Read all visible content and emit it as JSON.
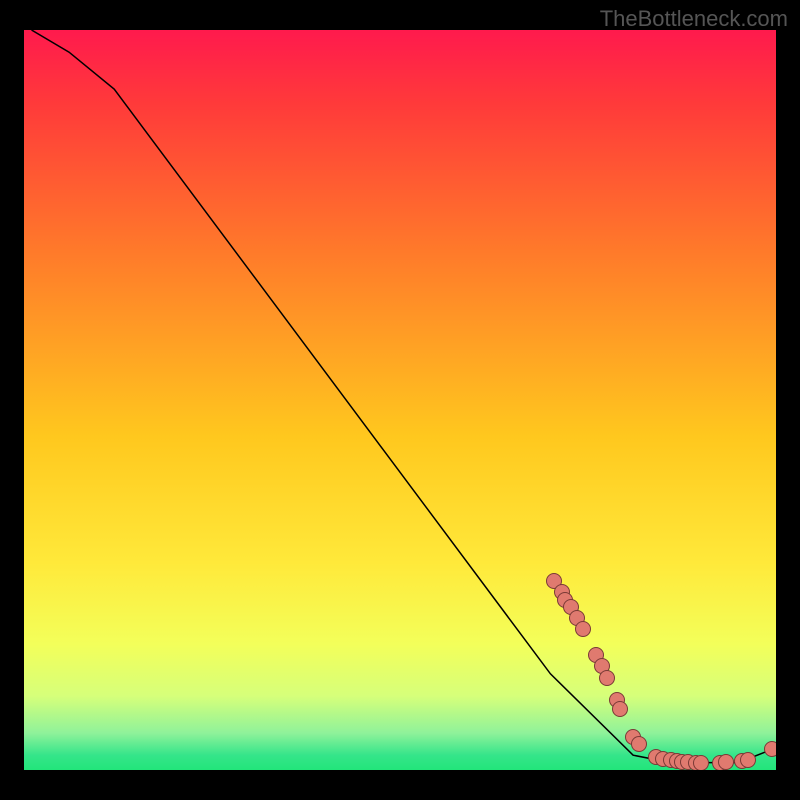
{
  "watermark": "TheBottleneck.com",
  "colors": {
    "marker_fill": "#e07a6f",
    "marker_stroke": "#7a3a37",
    "curve": "#000000",
    "gradient_top": "#ff1a4d",
    "gradient_mid": "#ffd500",
    "gradient_bottom": "#22e57a"
  },
  "chart_data": {
    "type": "line",
    "title": "",
    "xlabel": "",
    "ylabel": "",
    "xlim": [
      0,
      100
    ],
    "ylim": [
      0,
      100
    ],
    "grid": false,
    "legend": false,
    "curve": [
      {
        "x": 1,
        "y": 100
      },
      {
        "x": 6,
        "y": 97
      },
      {
        "x": 12,
        "y": 92
      },
      {
        "x": 70,
        "y": 13
      },
      {
        "x": 71,
        "y": 12
      },
      {
        "x": 81,
        "y": 2
      },
      {
        "x": 86,
        "y": 1
      },
      {
        "x": 95,
        "y": 1
      },
      {
        "x": 100,
        "y": 3
      }
    ],
    "series": [
      {
        "name": "markers",
        "points": [
          {
            "x": 70.5,
            "y": 25.5
          },
          {
            "x": 71.5,
            "y": 24.0
          },
          {
            "x": 72.0,
            "y": 23.0
          },
          {
            "x": 72.8,
            "y": 22.0
          },
          {
            "x": 73.5,
            "y": 20.5
          },
          {
            "x": 74.3,
            "y": 19.0
          },
          {
            "x": 76.0,
            "y": 15.5
          },
          {
            "x": 76.8,
            "y": 14.0
          },
          {
            "x": 77.5,
            "y": 12.5
          },
          {
            "x": 78.8,
            "y": 9.5
          },
          {
            "x": 79.3,
            "y": 8.3
          },
          {
            "x": 81.0,
            "y": 4.5
          },
          {
            "x": 81.8,
            "y": 3.5
          },
          {
            "x": 84.0,
            "y": 1.8
          },
          {
            "x": 85.0,
            "y": 1.5
          },
          {
            "x": 86.0,
            "y": 1.3
          },
          {
            "x": 86.8,
            "y": 1.2
          },
          {
            "x": 87.5,
            "y": 1.1
          },
          {
            "x": 88.3,
            "y": 1.1
          },
          {
            "x": 89.3,
            "y": 1.0
          },
          {
            "x": 90.0,
            "y": 1.0
          },
          {
            "x": 92.5,
            "y": 1.0
          },
          {
            "x": 93.3,
            "y": 1.1
          },
          {
            "x": 95.5,
            "y": 1.2
          },
          {
            "x": 96.3,
            "y": 1.3
          },
          {
            "x": 99.5,
            "y": 2.8
          }
        ]
      }
    ]
  }
}
